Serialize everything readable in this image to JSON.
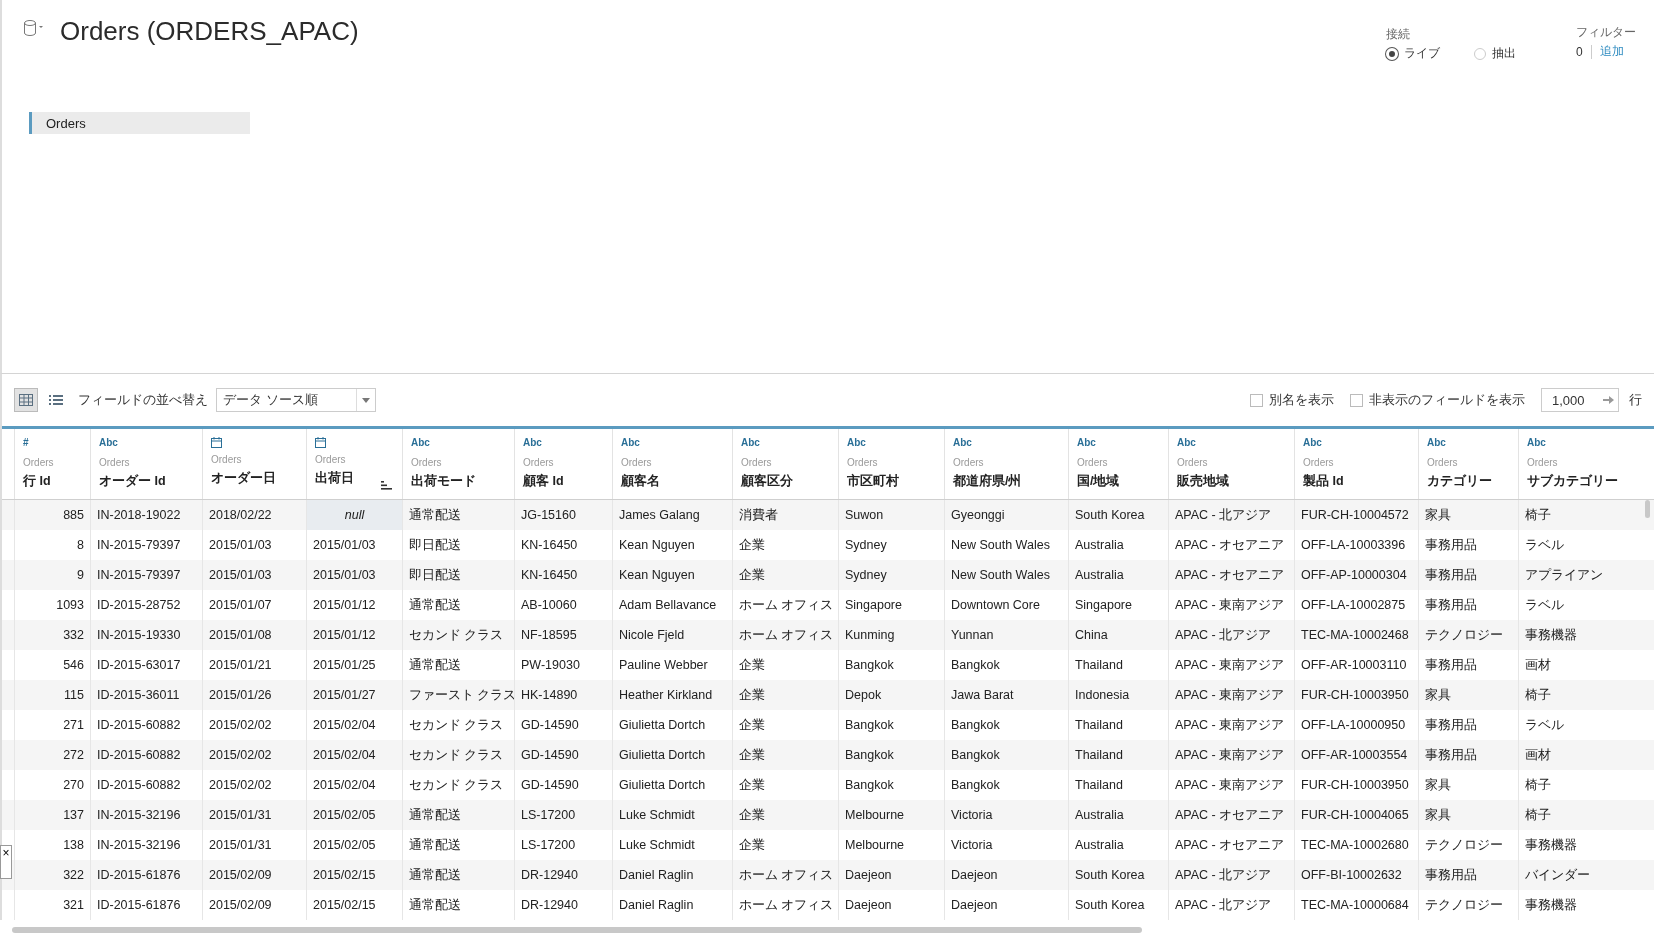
{
  "header": {
    "title": "Orders (ORDERS_APAC)"
  },
  "connection": {
    "label": "接続",
    "options": [
      {
        "label": "ライブ",
        "selected": true
      },
      {
        "label": "抽出",
        "selected": false
      }
    ]
  },
  "filters": {
    "label": "フィルター",
    "count": "0",
    "link": "追加"
  },
  "canvas": {
    "tables": [
      "Orders"
    ]
  },
  "toolbar": {
    "views": [
      {
        "kind": "grid",
        "selected": true
      },
      {
        "kind": "list",
        "selected": false
      }
    ],
    "sort_label": "フィールドの並べ替え",
    "sort_value": "データ ソース順",
    "checkboxes": [
      {
        "label": "別名を表示",
        "checked": false
      },
      {
        "label": "非表示のフィールドを表示",
        "checked": false
      }
    ],
    "rows_value": "1,000",
    "rows_label": "行"
  },
  "table": {
    "columns": [
      {
        "kind": "number",
        "type_label": "#",
        "source": "Orders",
        "name": "行 Id",
        "sorted": false
      },
      {
        "kind": "string",
        "type_label": "Abc",
        "source": "Orders",
        "name": "オーダー Id",
        "sorted": false
      },
      {
        "kind": "date",
        "source": "Orders",
        "name": "オーダー日",
        "sorted": false
      },
      {
        "kind": "date",
        "source": "Orders",
        "name": "出荷日",
        "sorted": true
      },
      {
        "kind": "string",
        "type_label": "Abc",
        "source": "Orders",
        "name": "出荷モード",
        "sorted": false
      },
      {
        "kind": "string",
        "type_label": "Abc",
        "source": "Orders",
        "name": "顧客 Id",
        "sorted": false
      },
      {
        "kind": "string",
        "type_label": "Abc",
        "source": "Orders",
        "name": "顧客名",
        "sorted": false
      },
      {
        "kind": "string",
        "type_label": "Abc",
        "source": "Orders",
        "name": "顧客区分",
        "sorted": false
      },
      {
        "kind": "string",
        "type_label": "Abc",
        "source": "Orders",
        "name": "市区町村",
        "sorted": false
      },
      {
        "kind": "string",
        "type_label": "Abc",
        "source": "Orders",
        "name": "都道府県/州",
        "sorted": false
      },
      {
        "kind": "string",
        "type_label": "Abc",
        "source": "Orders",
        "name": "国/地域",
        "sorted": false
      },
      {
        "kind": "string",
        "type_label": "Abc",
        "source": "Orders",
        "name": "販売地域",
        "sorted": false
      },
      {
        "kind": "string",
        "type_label": "Abc",
        "source": "Orders",
        "name": "製品 Id",
        "sorted": false
      },
      {
        "kind": "string",
        "type_label": "Abc",
        "source": "Orders",
        "name": "カテゴリー",
        "sorted": false
      },
      {
        "kind": "string",
        "type_label": "Abc",
        "source": "Orders",
        "name": "サブカテゴリー",
        "sorted": false
      }
    ],
    "rows": [
      [
        "885",
        "IN-2018-19022",
        "2018/02/22",
        {
          "text": "null",
          "kind": "null"
        },
        "通常配送",
        "JG-15160",
        "James Galang",
        "消費者",
        "Suwon",
        "Gyeonggi",
        "South Korea",
        "APAC - 北アジア",
        "FUR-CH-10004572",
        "家具",
        "椅子"
      ],
      [
        "8",
        "IN-2015-79397",
        "2015/01/03",
        "2015/01/03",
        "即日配送",
        "KN-16450",
        "Kean Nguyen",
        "企業",
        "Sydney",
        "New South Wales",
        "Australia",
        "APAC - オセアニア",
        "OFF-LA-10003396",
        "事務用品",
        "ラベル"
      ],
      [
        "9",
        "IN-2015-79397",
        "2015/01/03",
        "2015/01/03",
        "即日配送",
        "KN-16450",
        "Kean Nguyen",
        "企業",
        "Sydney",
        "New South Wales",
        "Australia",
        "APAC - オセアニア",
        "OFF-AP-10000304",
        "事務用品",
        "アプライアン"
      ],
      [
        "1093",
        "ID-2015-28752",
        "2015/01/07",
        "2015/01/12",
        "通常配送",
        "AB-10060",
        "Adam Bellavance",
        "ホーム オフィス",
        "Singapore",
        "Downtown Core",
        "Singapore",
        "APAC - 東南アジア",
        "OFF-LA-10002875",
        "事務用品",
        "ラベル"
      ],
      [
        "332",
        "IN-2015-19330",
        "2015/01/08",
        "2015/01/12",
        "セカンド クラス",
        "NF-18595",
        "Nicole Fjeld",
        "ホーム オフィス",
        "Kunming",
        "Yunnan",
        "China",
        "APAC - 北アジア",
        "TEC-MA-10002468",
        "テクノロジー",
        "事務機器"
      ],
      [
        "546",
        "ID-2015-63017",
        "2015/01/21",
        "2015/01/25",
        "通常配送",
        "PW-19030",
        "Pauline Webber",
        "企業",
        "Bangkok",
        "Bangkok",
        "Thailand",
        "APAC - 東南アジア",
        "OFF-AR-10003110",
        "事務用品",
        "画材"
      ],
      [
        "115",
        "ID-2015-36011",
        "2015/01/26",
        "2015/01/27",
        "ファースト クラス",
        "HK-14890",
        "Heather Kirkland",
        "企業",
        "Depok",
        "Jawa Barat",
        "Indonesia",
        "APAC - 東南アジア",
        "FUR-CH-10003950",
        "家具",
        "椅子"
      ],
      [
        "271",
        "ID-2015-60882",
        "2015/02/02",
        "2015/02/04",
        "セカンド クラス",
        "GD-14590",
        "Giulietta Dortch",
        "企業",
        "Bangkok",
        "Bangkok",
        "Thailand",
        "APAC - 東南アジア",
        "OFF-LA-10000950",
        "事務用品",
        "ラベル"
      ],
      [
        "272",
        "ID-2015-60882",
        "2015/02/02",
        "2015/02/04",
        "セカンド クラス",
        "GD-14590",
        "Giulietta Dortch",
        "企業",
        "Bangkok",
        "Bangkok",
        "Thailand",
        "APAC - 東南アジア",
        "OFF-AR-10003554",
        "事務用品",
        "画材"
      ],
      [
        "270",
        "ID-2015-60882",
        "2015/02/02",
        "2015/02/04",
        "セカンド クラス",
        "GD-14590",
        "Giulietta Dortch",
        "企業",
        "Bangkok",
        "Bangkok",
        "Thailand",
        "APAC - 東南アジア",
        "FUR-CH-10003950",
        "家具",
        "椅子"
      ],
      [
        "137",
        "IN-2015-32196",
        "2015/01/31",
        "2015/02/05",
        "通常配送",
        "LS-17200",
        "Luke Schmidt",
        "企業",
        "Melbourne",
        "Victoria",
        "Australia",
        "APAC - オセアニア",
        "FUR-CH-10004065",
        "家具",
        "椅子"
      ],
      [
        "138",
        "IN-2015-32196",
        "2015/01/31",
        "2015/02/05",
        "通常配送",
        "LS-17200",
        "Luke Schmidt",
        "企業",
        "Melbourne",
        "Victoria",
        "Australia",
        "APAC - オセアニア",
        "TEC-MA-10002680",
        "テクノロジー",
        "事務機器"
      ],
      [
        "322",
        "ID-2015-61876",
        "2015/02/09",
        "2015/02/15",
        "通常配送",
        "DR-12940",
        "Daniel Raglin",
        "ホーム オフィス",
        "Daejeon",
        "Daejeon",
        "South Korea",
        "APAC - 北アジア",
        "OFF-BI-10002632",
        "事務用品",
        "バインダー"
      ],
      [
        "321",
        "ID-2015-61876",
        "2015/02/09",
        "2015/02/15",
        "通常配送",
        "DR-12940",
        "Daniel Raglin",
        "ホーム オフィス",
        "Daejeon",
        "Daejeon",
        "South Korea",
        "APAC - 北アジア",
        "TEC-MA-10000684",
        "テクノロジー",
        "事務機器"
      ]
    ]
  },
  "close_tab": "×"
}
